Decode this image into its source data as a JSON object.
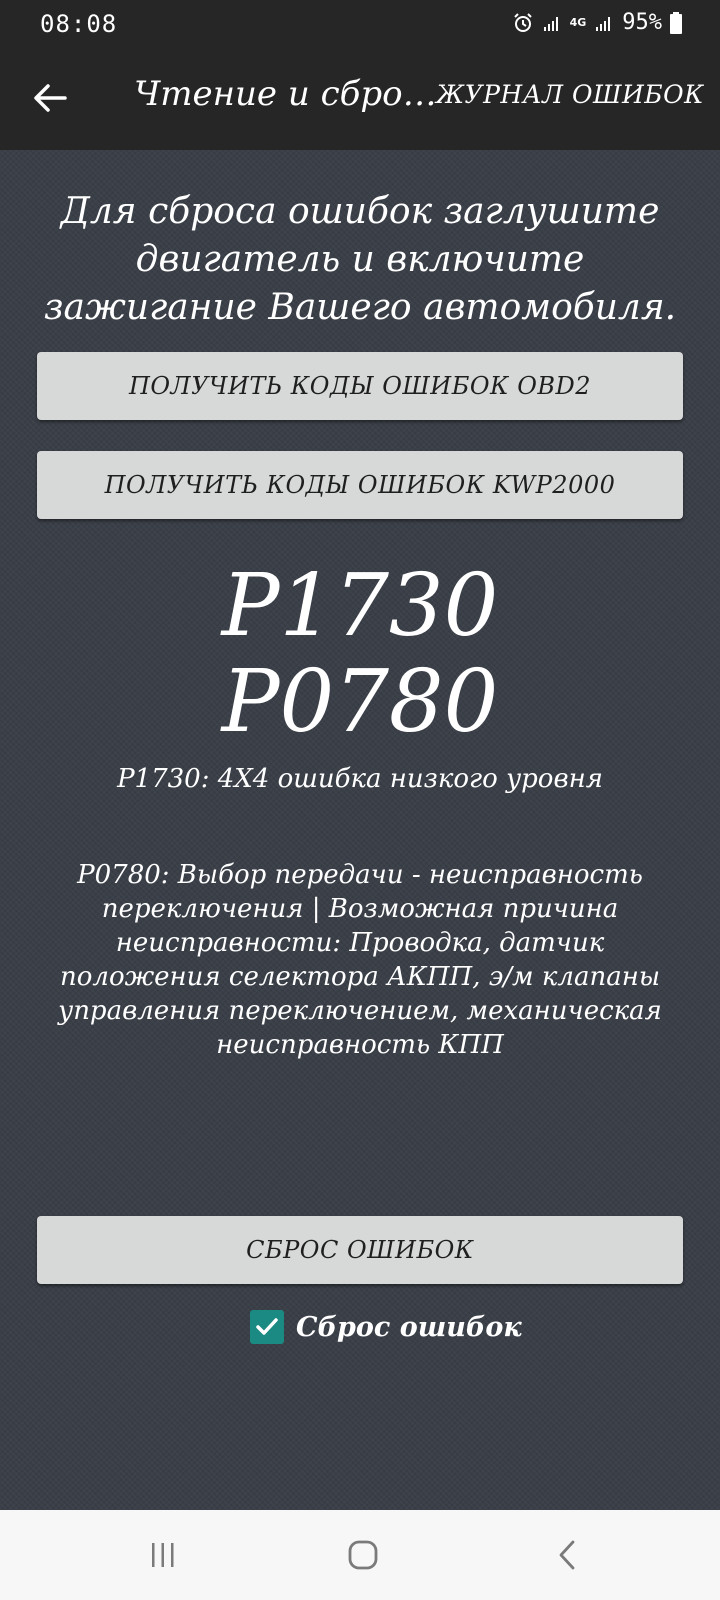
{
  "status_bar": {
    "time": "08:08",
    "network": "4G",
    "battery": "95%"
  },
  "app_bar": {
    "title": "Чтение и сброс о...",
    "journal_label": "ЖУРНАЛ ОШИБОК"
  },
  "main": {
    "instruction": "Для сброса ошибок заглушите двигатель и включите зажигание Вашего автомобиля.",
    "button_obd": "ПОЛУЧИТЬ КОДЫ ОШИБОК OBD2",
    "button_kwp": "ПОЛУЧИТЬ КОДЫ ОШИБОК KWP2000",
    "codes": [
      "P1730",
      "P0780"
    ],
    "description_1": "P1730: 4X4 ошибка низкого уровня",
    "description_2": "P0780: Выбор передачи - неисправность переключения | Возможная причина неисправности: Проводка, датчик положения селектора АКПП, э/м клапаны управления переключением, механическая неисправность КПП",
    "button_reset": "СБРОС ОШИБОК",
    "checkbox_label": "Сброс ошибок",
    "checkbox_checked": true,
    "checkbox_color": "#1a8a82"
  },
  "icons": {
    "back": "back-arrow-icon",
    "alarm": "alarm-icon",
    "signal": "signal-icon",
    "battery": "battery-icon",
    "recent": "recent-apps-icon",
    "home": "home-icon",
    "nav_back": "nav-back-icon"
  }
}
